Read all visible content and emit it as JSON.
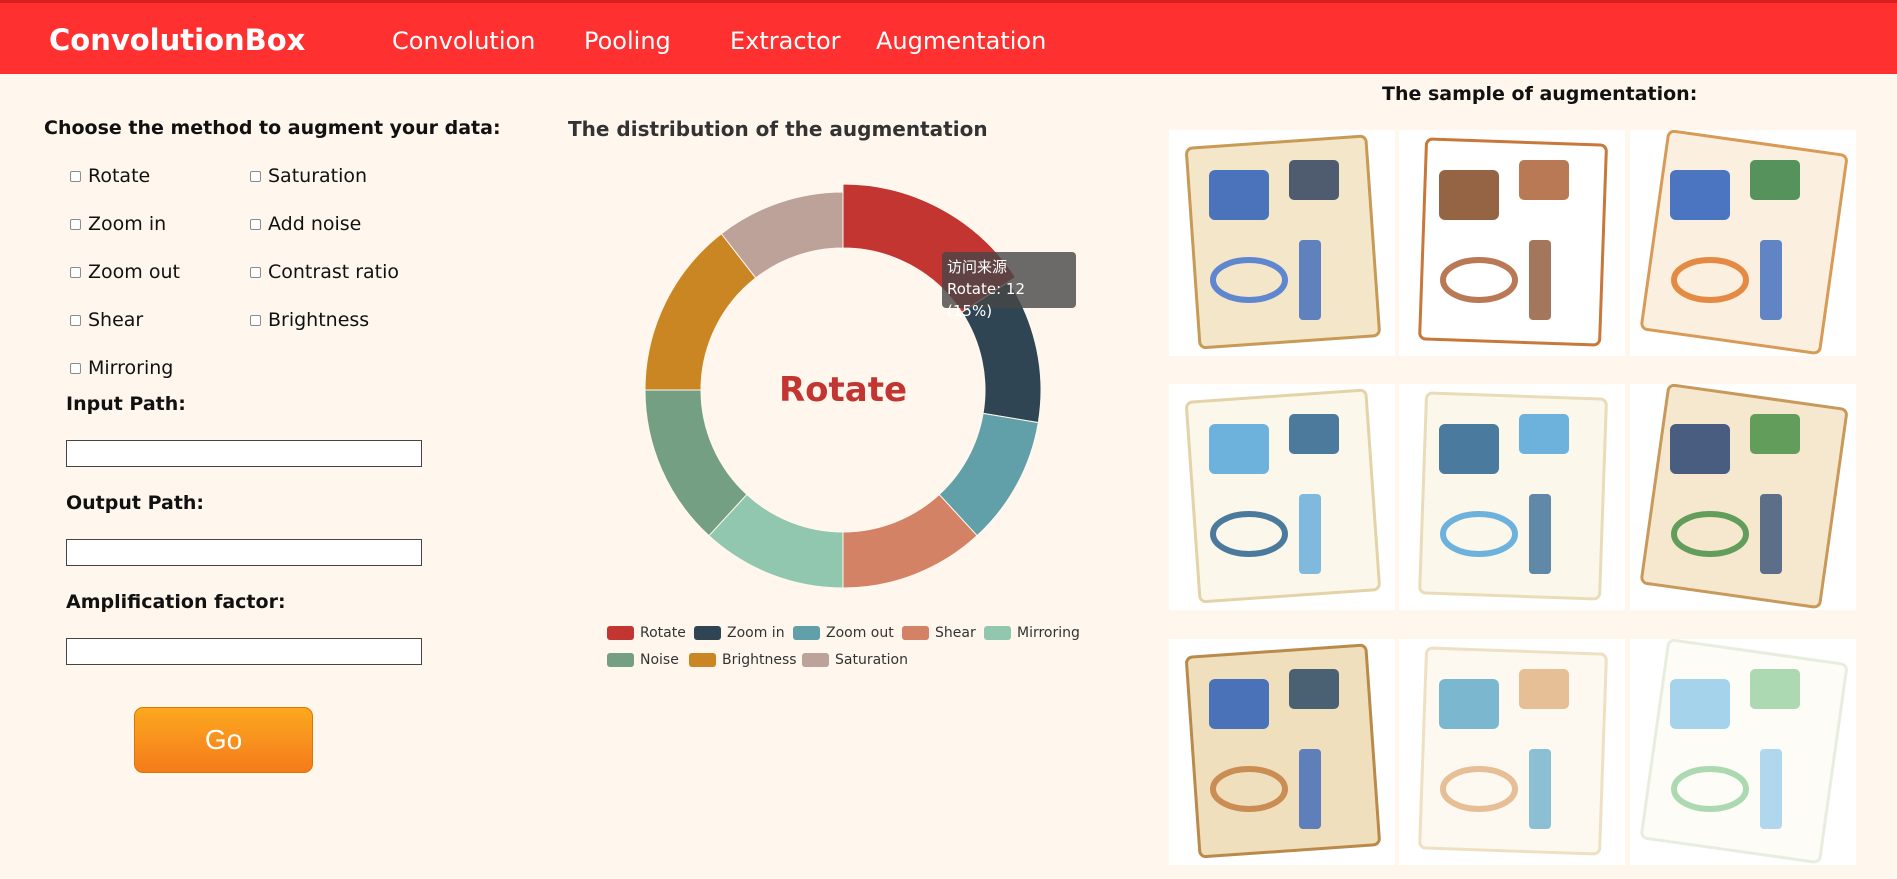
{
  "app": {
    "brand": "ConvolutionBox",
    "nav": [
      "Convolution",
      "Pooling",
      "Extractor",
      "Augmentation"
    ]
  },
  "form": {
    "heading": "Choose the method to augment your data:",
    "methods_col1": [
      "Rotate",
      "Zoom in",
      "Zoom out",
      "Shear",
      "Mirroring"
    ],
    "methods_col2": [
      "Saturation",
      "Add noise",
      "Contrast ratio",
      "Brightness"
    ],
    "input_path_label": "Input Path:",
    "input_path_value": "",
    "output_path_label": "Output Path:",
    "output_path_value": "",
    "amplification_label": "Amplification factor:",
    "amplification_value": "",
    "go_label": "Go"
  },
  "chart": {
    "title": "The distribution of the augmentation",
    "center_label": "Rotate",
    "tooltip_line1": "访问来源",
    "tooltip_line2": "Rotate: 12 (15%)"
  },
  "chart_data": {
    "type": "pie",
    "variant": "donut",
    "categories": [
      "Rotate",
      "Zoom in",
      "Zoom out",
      "Shear",
      "Mirroring",
      "Noise",
      "Brightness",
      "Saturation"
    ],
    "values": [
      12,
      9,
      8,
      9,
      9,
      10,
      11,
      8
    ],
    "colors": [
      "#c23531",
      "#2f4554",
      "#61a0a8",
      "#d48265",
      "#91c7ae",
      "#749f83",
      "#ca8622",
      "#bda29a"
    ],
    "legend_position": "bottom",
    "highlighted": "Rotate"
  },
  "samples": {
    "title": "The sample of augmentation:",
    "count": 9
  }
}
